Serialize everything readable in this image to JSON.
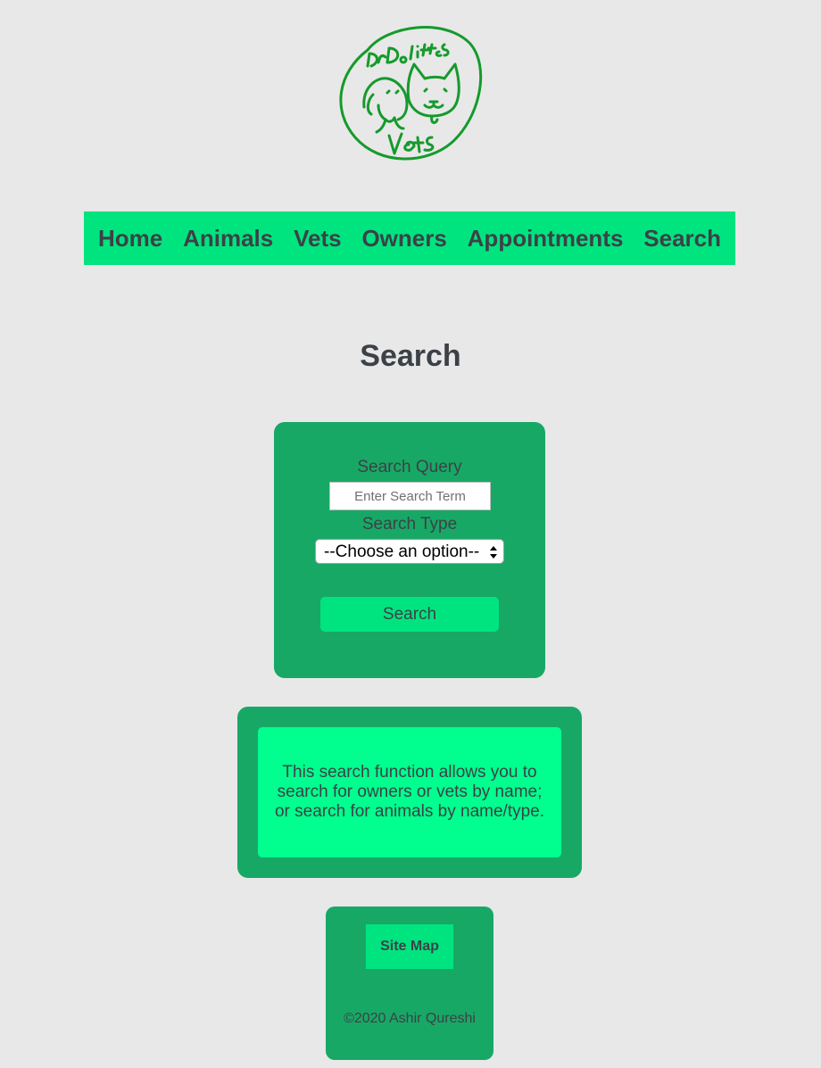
{
  "logo": {
    "alt": "Dr Dolittle's Vets",
    "color": "#159a2c"
  },
  "nav": {
    "items": [
      {
        "label": "Home"
      },
      {
        "label": "Animals"
      },
      {
        "label": "Vets"
      },
      {
        "label": "Owners"
      },
      {
        "label": "Appointments"
      },
      {
        "label": "Search"
      }
    ]
  },
  "main": {
    "title": "Search"
  },
  "search_form": {
    "query_label": "Search Query",
    "query_placeholder": "Enter Search Term",
    "query_value": "",
    "type_label": "Search Type",
    "type_selected": "--Choose an option--",
    "submit_label": "Search"
  },
  "info": {
    "text": "This search function allows you to search for owners or vets by name; or search for animals by name/type."
  },
  "footer": {
    "sitemap_label": "Site Map",
    "copyright": "©2020 Ashir Qureshi"
  },
  "colors": {
    "background": "#e8e8e8",
    "nav_green": "#00e47f",
    "card_green": "#18a866",
    "info_green": "#00ff8e",
    "text": "#3c4147"
  },
  "icons": {
    "select_arrows": "up-down-chevron-icon"
  }
}
